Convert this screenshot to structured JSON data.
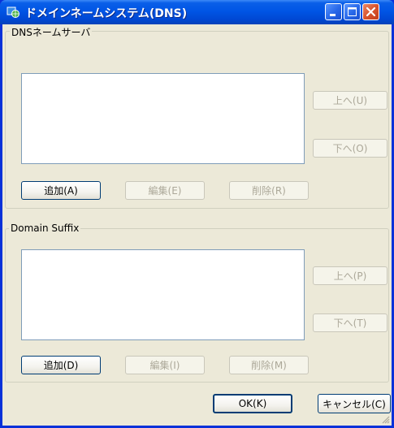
{
  "window": {
    "title": "ドメインネームシステム(DNS)"
  },
  "dns_servers": {
    "group_label": "DNSネームサーバ",
    "up_button": "上へ(U)",
    "down_button": "下へ(O)",
    "add_button": "追加(A)",
    "edit_button": "編集(E)",
    "delete_button": "削除(R)"
  },
  "domain_suffix": {
    "group_label": "Domain Suffix",
    "up_button": "上へ(P)",
    "down_button": "下へ(T)",
    "add_button": "追加(D)",
    "edit_button": "編集(I)",
    "delete_button": "削除(M)"
  },
  "footer": {
    "ok_button": "OK(K)",
    "cancel_button": "キャンセル(C)"
  },
  "colors": {
    "titlebar": "#0055e5",
    "dialog_background": "#ece9d8",
    "close_button": "#d9542d"
  },
  "icons": [
    "app-globe-icon",
    "minimize-icon",
    "maximize-icon",
    "close-icon",
    "resize-grip-icon"
  ]
}
